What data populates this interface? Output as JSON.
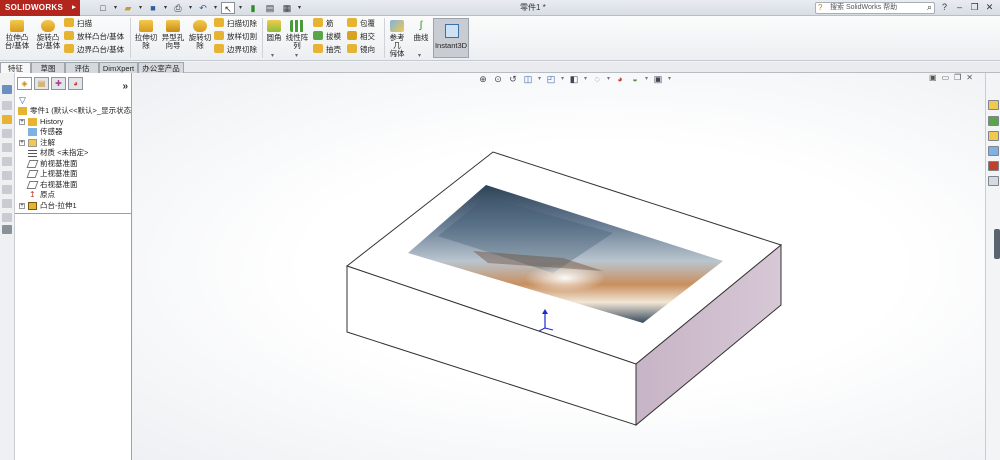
{
  "titlebar": {
    "logo": "SOLIDWORKS",
    "doc_title": "零件1 *",
    "search_placeholder": "搜索 SolidWorks 帮助"
  },
  "ribbon": {
    "extrude_boss": "拉伸凸\n台/基体",
    "revolve_boss": "旋转凸\n台/基体",
    "sweep": "扫描",
    "loft_boss": "放样凸台/基体",
    "boundary_boss": "边界凸台/基体",
    "extrude_cut": "拉伸切\n除",
    "hole_wizard": "异型孔\n向导",
    "revolve_cut": "旋转切\n除",
    "swept_cut": "扫描切除",
    "lofted_cut": "放样切割",
    "boundary_cut": "边界切除",
    "fillet": "圆角",
    "linear_pattern": "线性阵\n列",
    "rib": "筋",
    "draft": "拔模",
    "shell": "抽壳",
    "wrap": "包覆",
    "intersect": "相交",
    "mirror": "镜向",
    "ref_geometry": "参考几\n何体",
    "curves": "曲线",
    "instant3d": "Instant3D"
  },
  "cm_tabs": [
    "特征",
    "草图",
    "评估",
    "DimXpert",
    "办公室产品"
  ],
  "tree": {
    "root": "零件1 (默认<<默认>_显示状态",
    "items": [
      "History",
      "传感器",
      "注解",
      "材质 <未指定>",
      "前视基准面",
      "上视基准面",
      "右视基准面",
      "原点",
      "凸台-拉伸1"
    ]
  }
}
